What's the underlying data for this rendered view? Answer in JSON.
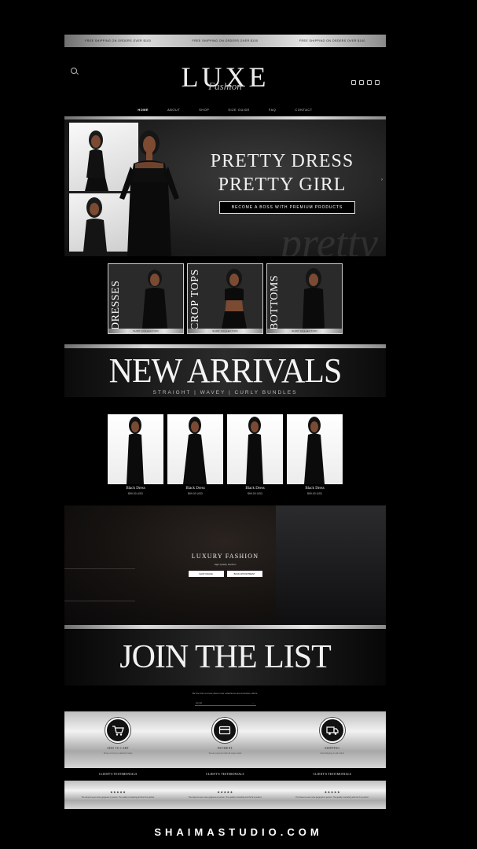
{
  "announcement": {
    "items": [
      "FREE SHIPPING ON ORDERS OVER $100",
      "FREE SHIPPING ON ORDERS OVER $100",
      "FREE SHIPPING ON ORDERS OVER $100"
    ]
  },
  "header": {
    "logo_main": "LUXE",
    "logo_script": "Fashion",
    "social_icons": [
      "facebook-icon",
      "pinterest-icon",
      "tiktok-icon",
      "instagram-icon"
    ]
  },
  "nav": {
    "items": [
      "HOME",
      "ABOUT",
      "SHOP",
      "SIZE GUIDE",
      "FAQ",
      "CONTACT"
    ]
  },
  "hero": {
    "title_line1": "PRETTY DRESS",
    "title_line2": "PRETTY GIRL",
    "button": "BECOME A BOSS WITH PREMIUM PRODUCTS",
    "watermark": "pretty"
  },
  "categories": [
    {
      "label": "DRESSES",
      "button": "SHOP COLLECTION"
    },
    {
      "label": "CROP TOPS",
      "button": "SHOP COLLECTION"
    },
    {
      "label": "BOTTOMS",
      "button": "SHOP COLLECTION"
    }
  ],
  "new_arrivals": {
    "title": "NEW ARRIVALS",
    "subtitle": "STRAIGHT | WAVEY | CURLY BUNDLES"
  },
  "products": [
    {
      "name": "Black Dress",
      "price": "$99.00 USD"
    },
    {
      "name": "Black Dress",
      "price": "$99.00 USD"
    },
    {
      "name": "Black Dress",
      "price": "$99.00 USD"
    },
    {
      "name": "Black Dress",
      "price": "$99.00 USD"
    }
  ],
  "luxury": {
    "title": "LUXURY FASHION",
    "subtitle": "High Quality Fashion",
    "button1": "SHOP ONLINE",
    "button2": "BOOK APPOINTMENT"
  },
  "join": {
    "title": "JOIN THE LIST",
    "copy": "Be the first to know about new collections and exclusive offers.",
    "email_placeholder": "Email",
    "arrow": "→"
  },
  "features": [
    {
      "title": "ADD TO CART",
      "desc": "Shop our luxury collection today",
      "icon": "cart-icon"
    },
    {
      "title": "PAYMENT",
      "desc": "Secure payment with all major cards",
      "icon": "card-icon"
    },
    {
      "title": "SHIPPING",
      "desc": "Fast shipping on all orders",
      "icon": "truck-icon"
    }
  ],
  "testimonials": {
    "headings": [
      "CLIENT'S TESTIMONIALS",
      "CLIENT'S TESTIMONIALS",
      "CLIENT'S TESTIMONIALS"
    ],
    "items": [
      {
        "stars": "★★★★★",
        "text": "The dress is even more gorgeous in person. The quality is amazing and the fit is perfect."
      },
      {
        "stars": "★★★★★",
        "text": "The dress is even more gorgeous in person. The quality is amazing and the fit is perfect."
      },
      {
        "stars": "★★★★★",
        "text": "The dress is even more gorgeous in person. The quality is amazing and the fit is perfect."
      }
    ]
  },
  "footer": {
    "brand": "SHAIMASTUDIO.COM"
  },
  "colors": {
    "background": "#000000",
    "silver_light": "#e4e4e4",
    "silver_dark": "#6f6f6f",
    "text": "#ffffff"
  }
}
